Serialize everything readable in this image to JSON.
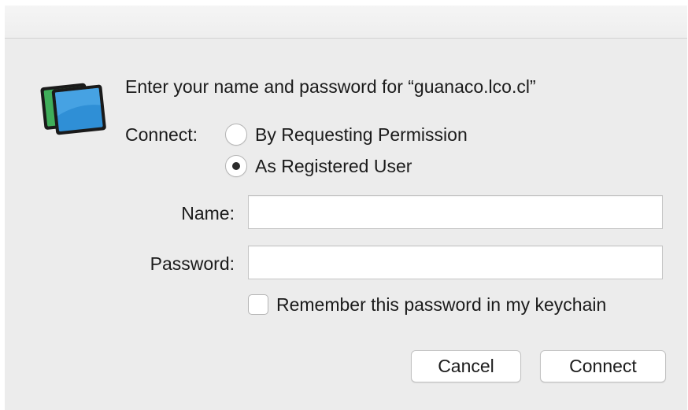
{
  "dialog": {
    "prompt": "Enter your name and password for “guanaco.lco.cl”",
    "connect_label": "Connect:",
    "connect_options": [
      {
        "label": "By Requesting Permission",
        "selected": false
      },
      {
        "label": "As Registered User",
        "selected": true
      }
    ],
    "name_label": "Name:",
    "name_value": "",
    "password_label": "Password:",
    "password_value": "",
    "remember_label": "Remember this password in my keychain",
    "remember_checked": false,
    "cancel_label": "Cancel",
    "connect_button_label": "Connect"
  },
  "icon": {
    "name": "screen-sharing-icon",
    "colors": {
      "frame": "#1a1a1a",
      "back_screen": "#3fae5a",
      "front_screen": "#2f8fd6"
    }
  }
}
